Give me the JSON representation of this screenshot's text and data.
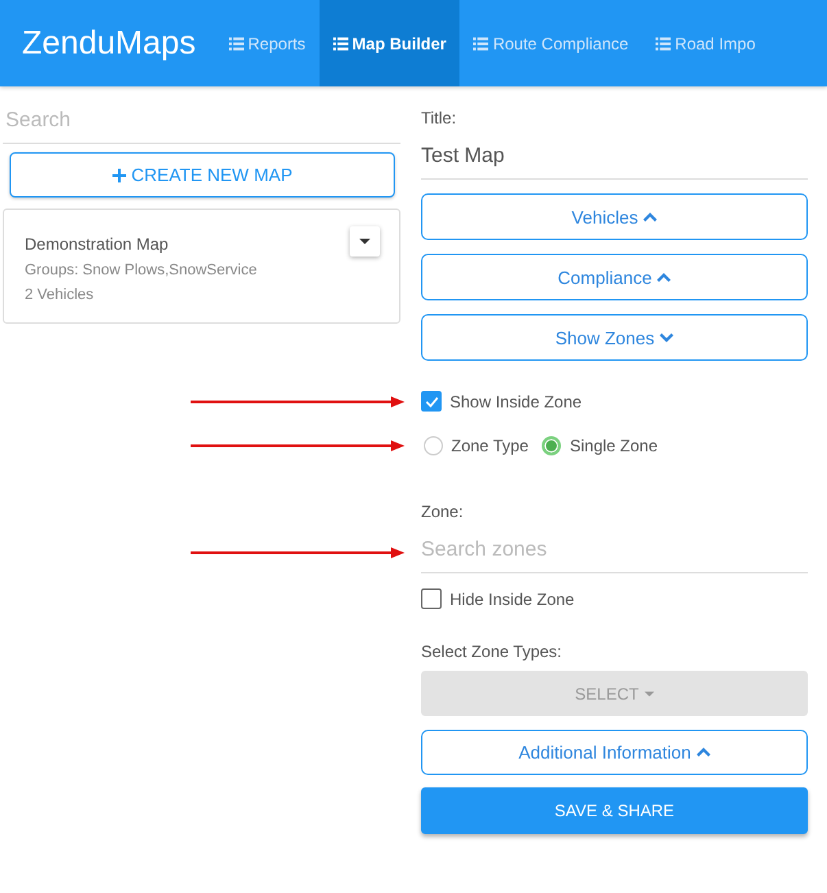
{
  "header": {
    "logo": "ZenduMaps",
    "tabs": [
      {
        "label": "Reports",
        "selected": false
      },
      {
        "label": "Map Builder",
        "selected": true
      },
      {
        "label": "Route Compliance",
        "selected": false
      },
      {
        "label": "Road Impo",
        "selected": false
      }
    ]
  },
  "sidebar": {
    "search": {
      "placeholder": "Search"
    },
    "create_button": "CREATE NEW MAP",
    "maps": [
      {
        "name": "Demonstration Map",
        "groups": "Groups: Snow Plows,SnowService",
        "vehicles": "2 Vehicles"
      }
    ]
  },
  "form": {
    "title_label": "Title:",
    "title_value": "Test Map",
    "sections": [
      {
        "label": "Vehicles",
        "expanded": false
      },
      {
        "label": "Compliance",
        "expanded": false
      },
      {
        "label": "Show Zones",
        "expanded": true
      }
    ],
    "show_inside_zone": {
      "label": "Show Inside Zone",
      "checked": true,
      "arrow": true
    },
    "zone_radios": {
      "arrow": true,
      "options": [
        {
          "label": "Zone Type",
          "selected": false
        },
        {
          "label": "Single Zone",
          "selected": true
        }
      ]
    },
    "zone_label": "Zone:",
    "zone_search": {
      "placeholder": "Search zones",
      "arrow": true
    },
    "hide_inside_zone": {
      "label": "Hide Inside Zone",
      "checked": false
    },
    "zone_types_label": "Select Zone Types:",
    "select_button": "SELECT",
    "additional": {
      "label": "Additional Information",
      "expanded": false
    },
    "save_button": "SAVE & SHARE"
  }
}
